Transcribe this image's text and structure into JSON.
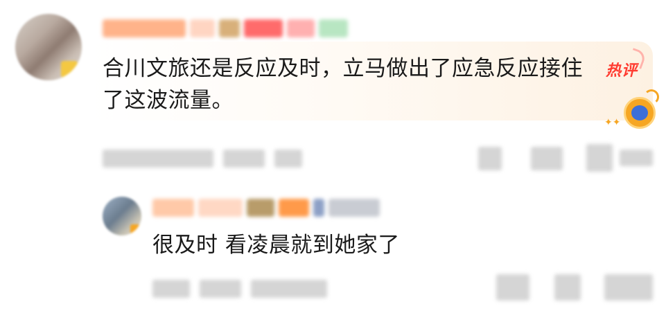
{
  "comment": {
    "badge": "热评",
    "text_line1": "合川文旅还是反应及时，立马做出了应急反应接住",
    "text_line2": "了这波流量。"
  },
  "reply": {
    "text": "很及时 看凌晨就到她家了"
  },
  "colors": {
    "badge_red": "#ff3b30",
    "bubble_tint": "#fdf1e2",
    "text": "#1a1a1a",
    "mascot_orange": "#f6a623",
    "mascot_blue": "#3d6fd8"
  },
  "icons": {
    "mascot": "astronaut-mascot-icon",
    "sparkle": "sparkle-icon"
  }
}
